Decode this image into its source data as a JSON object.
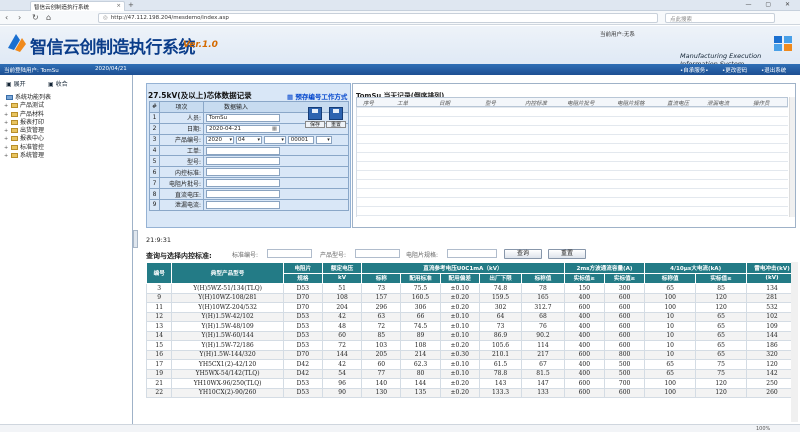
{
  "browser": {
    "tab_title": "智信云创制造执行系统",
    "url": "http://47.112.198.204/mesdemo/index.asp",
    "search_placeholder": "点此搜索"
  },
  "header": {
    "app_title": "智信云创制造执行系统",
    "version": "Ver.1.0",
    "current_user": "当前用户:无系",
    "subtitle": "Manufacturing Execution Information System"
  },
  "bluebar": {
    "login_user": "当前登陆用户: TomSu",
    "date": "2020/04/21",
    "links": [
      "•自承服务•",
      "•更改密码",
      "•退出系统"
    ]
  },
  "sidebar": {
    "expand": "展开",
    "collapse": "收合",
    "root": "系统功能列表",
    "items": [
      "产品测试",
      "产品材料",
      "报表打印",
      "出货管理",
      "报表中心",
      "标准管控",
      "系统管理"
    ]
  },
  "form": {
    "title": "27.5kV(及以上)芯体数据记录",
    "link": "预存编号工作方式",
    "col_no": "#",
    "col_item": "项次",
    "col_input": "数据输入",
    "rows": [
      {
        "n": "1",
        "label": "人员:",
        "value": "TomSu"
      },
      {
        "n": "2",
        "label": "日期:",
        "value": "2020-04-21"
      },
      {
        "n": "3",
        "label": "产品编号:",
        "year": "2020",
        "month": "04",
        "day": "",
        "serial": "00001"
      },
      {
        "n": "4",
        "label": "工单:",
        "value": ""
      },
      {
        "n": "5",
        "label": "型号:",
        "value": ""
      },
      {
        "n": "6",
        "label": "内控标准:",
        "value": ""
      },
      {
        "n": "7",
        "label": "电阻片批号:",
        "value": ""
      },
      {
        "n": "8",
        "label": "直流电压:",
        "value": ""
      },
      {
        "n": "9",
        "label": "泄漏电流:",
        "value": ""
      }
    ],
    "save": "保存",
    "reset": "重置"
  },
  "records": {
    "title": "TomSu 当天记录(倒序排列)",
    "columns": [
      "序号",
      "工单",
      "日期",
      "型号",
      "内控标准",
      "电阻片批号",
      "电阻片规格",
      "直流电压",
      "泄漏电流",
      "操作员"
    ]
  },
  "query": {
    "time": "21:9:31",
    "label": "查询与选择内控标准:",
    "f1": "标准编号:",
    "f2": "产品型号:",
    "f3": "电阻片规格:",
    "search": "查询",
    "reset": "重置"
  },
  "table": {
    "head1": [
      "编号",
      "典型产品型号",
      "电阻片",
      "额定电压",
      "直流参考电压U0C1mA（kV）",
      "",
      "",
      "",
      "2ms方波通流容量(A)",
      "",
      "4/10μs大电流(kA)",
      "",
      "雷电冲击(kV)"
    ],
    "head2": [
      "",
      "",
      "规格",
      "kV",
      "标称",
      "配用标准",
      "配用偏差",
      "出厂下限",
      "标称值",
      "实标值≥",
      "实标值≥",
      "标称值",
      "实标值≥",
      "(kV)"
    ],
    "rows": [
      [
        "3",
        "Y(H)5WZ-51/134(TLQ)",
        "D53",
        "51",
        "73",
        "75.5",
        "±0.10",
        "74.8",
        "78",
        "150",
        "300",
        "65",
        "85",
        "134"
      ],
      [
        "9",
        "Y(H)10WZ-108/281",
        "D70",
        "108",
        "157",
        "160.5",
        "±0.20",
        "159.5",
        "165",
        "400",
        "600",
        "100",
        "120",
        "281"
      ],
      [
        "11",
        "Y(H)10WZ-204/532",
        "D70",
        "204",
        "296",
        "306",
        "±0.20",
        "302",
        "312.7",
        "600",
        "600",
        "100",
        "120",
        "532"
      ],
      [
        "12",
        "Y(H)1.5W-42/102",
        "D53",
        "42",
        "63",
        "66",
        "±0.10",
        "64",
        "68",
        "400",
        "600",
        "10",
        "65",
        "102"
      ],
      [
        "13",
        "Y(H)1.5W-48/109",
        "D53",
        "48",
        "72",
        "74.5",
        "±0.10",
        "73",
        "76",
        "400",
        "600",
        "10",
        "65",
        "109"
      ],
      [
        "14",
        "Y(H)1.5W-60/144",
        "D53",
        "60",
        "85",
        "89",
        "±0.10",
        "86.9",
        "90.2",
        "400",
        "600",
        "10",
        "65",
        "144"
      ],
      [
        "15",
        "Y(H)1.5W-72/186",
        "D53",
        "72",
        "103",
        "108",
        "±0.20",
        "105.6",
        "114",
        "400",
        "600",
        "10",
        "65",
        "186"
      ],
      [
        "16",
        "Y(H)1.5W-144/320",
        "D70",
        "144",
        "205",
        "214",
        "±0.30",
        "210.1",
        "217",
        "600",
        "800",
        "10",
        "65",
        "320"
      ],
      [
        "17",
        "YH5CX1(2)-42/120",
        "D42",
        "42",
        "60",
        "62.3",
        "±0.10",
        "61.5",
        "67",
        "400",
        "500",
        "65",
        "75",
        "120"
      ],
      [
        "19",
        "YH5WX-54/142(TLQ)",
        "D42",
        "54",
        "77",
        "80",
        "±0.10",
        "78.8",
        "81.5",
        "400",
        "500",
        "65",
        "75",
        "142"
      ],
      [
        "21",
        "YH10WX-96/250(TLQ)",
        "D53",
        "96",
        "140",
        "144",
        "±0.20",
        "143",
        "147",
        "600",
        "700",
        "100",
        "120",
        "250"
      ],
      [
        "22",
        "YH10CX(2)-90/260",
        "D53",
        "90",
        "130",
        "135",
        "±0.20",
        "133.3",
        "133",
        "600",
        "600",
        "100",
        "120",
        "260"
      ]
    ]
  },
  "status": {
    "zoom": "100%"
  }
}
